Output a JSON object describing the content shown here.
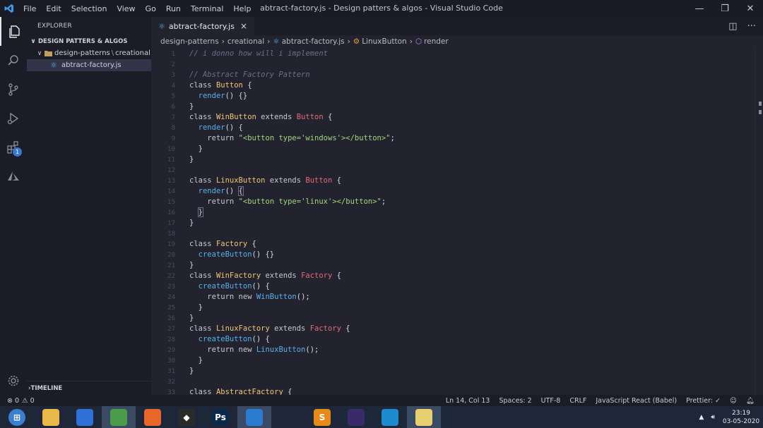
{
  "window": {
    "title": "abtract-factory.js - Design patters & algos - Visual Studio Code",
    "menu": [
      "File",
      "Edit",
      "Selection",
      "View",
      "Go",
      "Run",
      "Terminal",
      "Help"
    ]
  },
  "activity": {
    "items": [
      {
        "name": "explorer-icon",
        "active": true
      },
      {
        "name": "search-icon",
        "active": false
      },
      {
        "name": "source-control-icon",
        "active": false
      },
      {
        "name": "run-debug-icon",
        "active": false
      },
      {
        "name": "extensions-icon",
        "active": false,
        "badge": "1"
      },
      {
        "name": "azure-icon",
        "active": false
      }
    ],
    "settings_icon": "gear-icon"
  },
  "sidebar": {
    "title": "EXPLORER",
    "section": "DESIGN PATTERS & ALGOS",
    "folder": "design-patterns",
    "subfolder": "creational",
    "file": "abtract-factory.js",
    "timeline": "TIMELINE"
  },
  "editor": {
    "tab_label": "abtract-factory.js",
    "close_glyph": "×",
    "breadcrumb": [
      "design-patterns",
      "creational",
      "abtract-factory.js",
      "LinuxButton",
      "render"
    ],
    "lines": [
      {
        "n": "1",
        "t": [
          [
            "cm",
            "// i donno how will i implement"
          ]
        ]
      },
      {
        "n": "2",
        "t": []
      },
      {
        "n": "3",
        "t": [
          [
            "cm",
            "// Abstract Factory Pattern"
          ]
        ]
      },
      {
        "n": "4",
        "t": [
          [
            "kw",
            "class "
          ],
          [
            "cls",
            "Button"
          ],
          [
            "pl",
            " {"
          ]
        ]
      },
      {
        "n": "5",
        "t": [
          [
            "pl",
            "  "
          ],
          [
            "fn",
            "render"
          ],
          [
            "pl",
            "() {}"
          ]
        ]
      },
      {
        "n": "6",
        "t": [
          [
            "pl",
            "}"
          ]
        ]
      },
      {
        "n": "7",
        "t": [
          [
            "kw",
            "class "
          ],
          [
            "cls",
            "WinButton"
          ],
          [
            "kw",
            " extends "
          ],
          [
            "ext",
            "Button"
          ],
          [
            "pl",
            " {"
          ]
        ]
      },
      {
        "n": "8",
        "t": [
          [
            "pl",
            "  "
          ],
          [
            "fn",
            "render"
          ],
          [
            "pl",
            "() {"
          ]
        ]
      },
      {
        "n": "9",
        "t": [
          [
            "pl",
            "    "
          ],
          [
            "kw",
            "return "
          ],
          [
            "str",
            "\"<button type='windows'></button>\""
          ],
          [
            "pl",
            ";"
          ]
        ]
      },
      {
        "n": "10",
        "t": [
          [
            "pl",
            "  }"
          ]
        ]
      },
      {
        "n": "11",
        "t": [
          [
            "pl",
            "}"
          ]
        ]
      },
      {
        "n": "12",
        "t": []
      },
      {
        "n": "13",
        "t": [
          [
            "kw",
            "class "
          ],
          [
            "cls",
            "LinuxButton"
          ],
          [
            "kw",
            " extends "
          ],
          [
            "ext",
            "Button"
          ],
          [
            "pl",
            " {"
          ]
        ]
      },
      {
        "n": "14",
        "t": [
          [
            "pl",
            "  "
          ],
          [
            "fn",
            "render"
          ],
          [
            "pl",
            "() "
          ],
          [
            "hl",
            "{"
          ]
        ]
      },
      {
        "n": "15",
        "t": [
          [
            "pl",
            "    "
          ],
          [
            "kw",
            "return "
          ],
          [
            "str",
            "\"<button type='linux'></button>\""
          ],
          [
            "pl",
            ";"
          ]
        ]
      },
      {
        "n": "16",
        "t": [
          [
            "pl",
            "  "
          ],
          [
            "hl",
            "}"
          ]
        ]
      },
      {
        "n": "17",
        "t": [
          [
            "pl",
            "}"
          ]
        ]
      },
      {
        "n": "18",
        "t": []
      },
      {
        "n": "19",
        "t": [
          [
            "kw",
            "class "
          ],
          [
            "cls",
            "Factory"
          ],
          [
            "pl",
            " {"
          ]
        ]
      },
      {
        "n": "20",
        "t": [
          [
            "pl",
            "  "
          ],
          [
            "fn",
            "createButton"
          ],
          [
            "pl",
            "() {}"
          ]
        ]
      },
      {
        "n": "21",
        "t": [
          [
            "pl",
            "}"
          ]
        ]
      },
      {
        "n": "22",
        "t": [
          [
            "kw",
            "class "
          ],
          [
            "cls",
            "WinFactory"
          ],
          [
            "kw",
            " extends "
          ],
          [
            "ext",
            "Factory"
          ],
          [
            "pl",
            " {"
          ]
        ]
      },
      {
        "n": "23",
        "t": [
          [
            "pl",
            "  "
          ],
          [
            "fn",
            "createButton"
          ],
          [
            "pl",
            "() {"
          ]
        ]
      },
      {
        "n": "24",
        "t": [
          [
            "pl",
            "    "
          ],
          [
            "kw",
            "return new "
          ],
          [
            "fn",
            "WinButton"
          ],
          [
            "pl",
            "();"
          ]
        ]
      },
      {
        "n": "25",
        "t": [
          [
            "pl",
            "  }"
          ]
        ]
      },
      {
        "n": "26",
        "t": [
          [
            "pl",
            "}"
          ]
        ]
      },
      {
        "n": "27",
        "t": [
          [
            "kw",
            "class "
          ],
          [
            "cls",
            "LinuxFactory"
          ],
          [
            "kw",
            " extends "
          ],
          [
            "ext",
            "Factory"
          ],
          [
            "pl",
            " {"
          ]
        ]
      },
      {
        "n": "28",
        "t": [
          [
            "pl",
            "  "
          ],
          [
            "fn",
            "createButton"
          ],
          [
            "pl",
            "() {"
          ]
        ]
      },
      {
        "n": "29",
        "t": [
          [
            "pl",
            "    "
          ],
          [
            "kw",
            "return new "
          ],
          [
            "fn",
            "LinuxButton"
          ],
          [
            "pl",
            "();"
          ]
        ]
      },
      {
        "n": "30",
        "t": [
          [
            "pl",
            "  }"
          ]
        ]
      },
      {
        "n": "31",
        "t": [
          [
            "pl",
            "}"
          ]
        ]
      },
      {
        "n": "32",
        "t": []
      },
      {
        "n": "33",
        "t": [
          [
            "kw",
            "class "
          ],
          [
            "cls",
            "AbstractFactory"
          ],
          [
            "pl",
            " {"
          ]
        ]
      }
    ]
  },
  "status": {
    "errors": "⊗ 0",
    "warnings": "⚠ 0",
    "position": "Ln 14, Col 13",
    "spaces": "Spaces: 2",
    "encoding": "UTF-8",
    "eol": "CRLF",
    "language": "JavaScript React (Babel)",
    "prettier": "Prettier: ✓"
  },
  "taskbar": {
    "apps": [
      {
        "name": "windows-start-icon",
        "color": "#3b7fd0",
        "glyph": "⊞",
        "active": false
      },
      {
        "name": "file-explorer-icon",
        "color": "#e8b84a",
        "glyph": "",
        "active": false
      },
      {
        "name": "firefox-blue-icon",
        "color": "#2f6fd8",
        "glyph": "",
        "active": false
      },
      {
        "name": "chrome-icon",
        "color": "#4a9a4a",
        "glyph": "",
        "active": true
      },
      {
        "name": "firefox-icon",
        "color": "#e8662a",
        "glyph": "",
        "active": false
      },
      {
        "name": "inkscape-icon",
        "color": "#2a2a2a",
        "glyph": "◆",
        "active": false
      },
      {
        "name": "photoshop-icon",
        "color": "#0b2a4a",
        "glyph": "Ps",
        "active": false
      },
      {
        "name": "vscode-icon",
        "color": "#2a7ad0",
        "glyph": "",
        "active": true
      },
      {
        "name": "figma-icon",
        "color": "#1e2738",
        "glyph": "",
        "active": false
      },
      {
        "name": "sublime-icon",
        "color": "#e88a1a",
        "glyph": "S",
        "active": false
      },
      {
        "name": "eclipse-icon",
        "color": "#3a2a6a",
        "glyph": "",
        "active": false
      },
      {
        "name": "edge-icon",
        "color": "#1e8ad0",
        "glyph": "",
        "active": false
      },
      {
        "name": "folder-icon",
        "color": "#e8d070",
        "glyph": "",
        "active": true
      }
    ],
    "time": "23:19",
    "date": "03-05-2020"
  }
}
